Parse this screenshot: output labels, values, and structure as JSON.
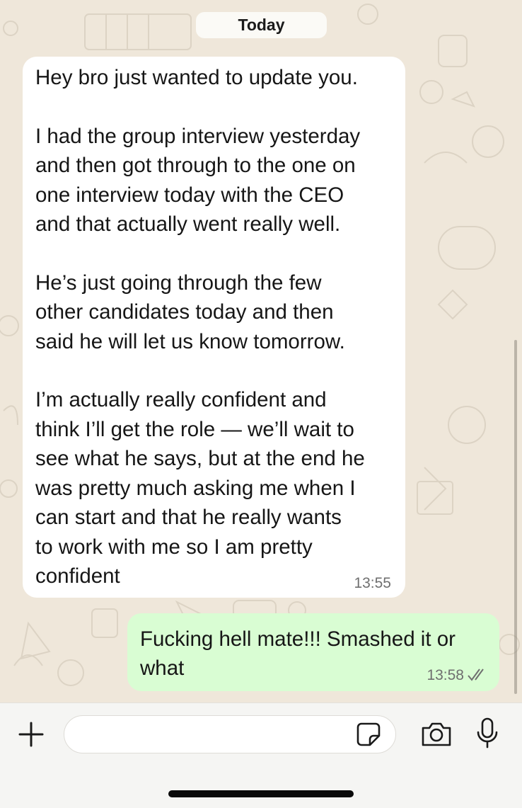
{
  "date_separator": "Today",
  "messages": [
    {
      "direction": "incoming",
      "text": "Hey bro just wanted to update you.\n\nI had the group interview yesterday\nand then got through to the one on\none interview today with the CEO\nand that actually went really well.\n\nHe’s just going through the few\nother candidates today and then\nsaid he will let us know tomorrow.\n\nI’m actually really confident and\nthink I’ll get the role — we’ll wait to\nsee what he says, but at the end he\nwas pretty much asking me when I\ncan start and that he really wants\nto work with me so I am pretty\nconfident",
      "time": "13:55"
    },
    {
      "direction": "outgoing",
      "text": "Fucking hell mate!!! Smashed it or\nwhat",
      "time": "13:58",
      "status_icon": "double-check-icon"
    }
  ],
  "composer": {
    "placeholder": "",
    "buttons": [
      "plus-icon",
      "sticker-icon",
      "camera-icon",
      "microphone-icon"
    ]
  },
  "colors": {
    "chat_background": "#efe7da",
    "incoming_bubble": "#ffffff",
    "outgoing_bubble": "#d9fdd3",
    "timestamp": "#6f6f6f",
    "input_bar": "#f5f5f3"
  }
}
